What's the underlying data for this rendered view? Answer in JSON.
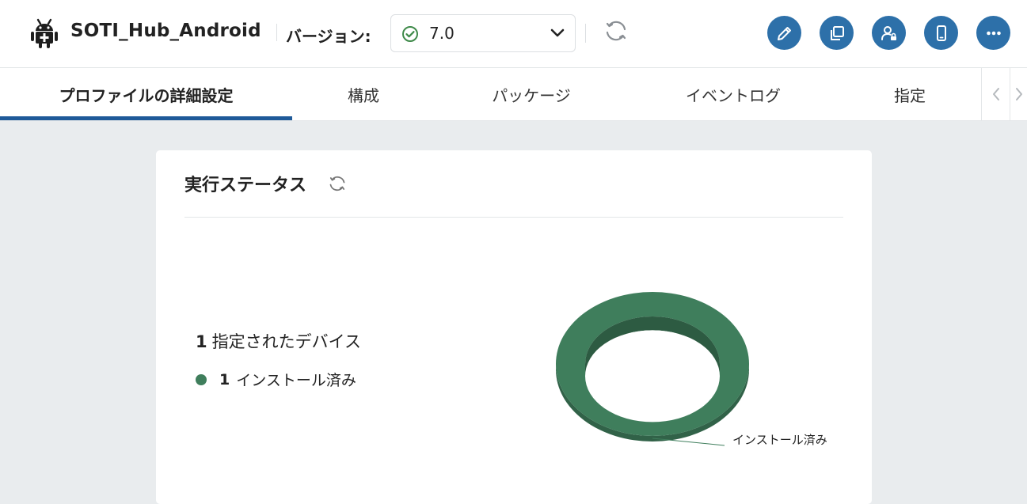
{
  "header": {
    "app_title": "SOTI_Hub_Android",
    "version_label": "バージョン:",
    "version_value": "7.0",
    "actions": [
      {
        "name": "edit-button",
        "icon": "pencil-icon"
      },
      {
        "name": "copy-button",
        "icon": "copy-icon"
      },
      {
        "name": "user-lock-button",
        "icon": "user-lock-icon"
      },
      {
        "name": "device-button",
        "icon": "phone-icon"
      },
      {
        "name": "more-button",
        "icon": "more-icon"
      }
    ],
    "accent_color": "#2d70a9"
  },
  "tabs": [
    {
      "label": "プロファイルの詳細設定",
      "active": true
    },
    {
      "label": "構成",
      "active": false
    },
    {
      "label": "パッケージ",
      "active": false
    },
    {
      "label": "イベントログ",
      "active": false
    },
    {
      "label": "指定",
      "active": false
    }
  ],
  "status_card": {
    "title": "実行ステータス",
    "total_count": "1",
    "total_label": "指定されたデバイス",
    "legend": [
      {
        "count": "1",
        "label": "インストール済み",
        "color": "#3f7e5c"
      }
    ]
  },
  "chart_data": {
    "type": "pie",
    "style": "donut-3d",
    "categories": [
      "インストール済み"
    ],
    "values": [
      1
    ],
    "colors": [
      "#3f7e5c"
    ],
    "slice_labels": [
      "インストール済み"
    ]
  }
}
